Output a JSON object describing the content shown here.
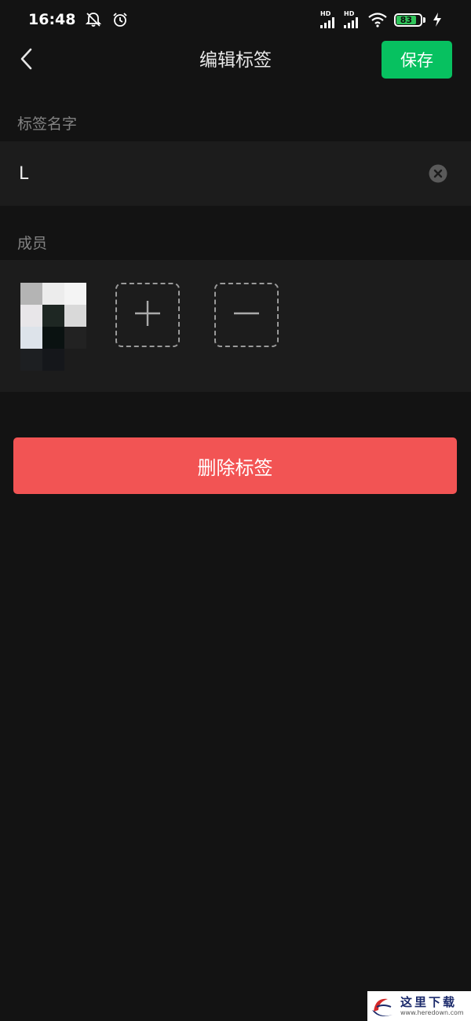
{
  "status_bar": {
    "time": "16:48",
    "icons": [
      "bell-off-icon",
      "alarm-icon",
      "signal-icon",
      "signal-icon",
      "wifi-icon",
      "battery-icon",
      "charging-icon"
    ],
    "signal_label": "HD",
    "battery_level": "83",
    "battery_percent": 83
  },
  "nav": {
    "back_icon": "chevron-left-icon",
    "title": "编辑标签",
    "save_label": "保存"
  },
  "tag_name": {
    "section_label": "标签名字",
    "value": "L",
    "clear_icon": "clear-circle-icon"
  },
  "members": {
    "section_label": "成员",
    "avatar_icon": "member-avatar",
    "add_icon": "plus-icon",
    "remove_icon": "minus-icon"
  },
  "delete_label": "删除标签",
  "watermark": {
    "text": "这里下载",
    "url": "www.heredown.com"
  },
  "colors": {
    "background": "#131313",
    "panel": "#1c1c1c",
    "primary_green": "#07c160",
    "danger_red": "#f25454",
    "label_gray": "#838383"
  }
}
